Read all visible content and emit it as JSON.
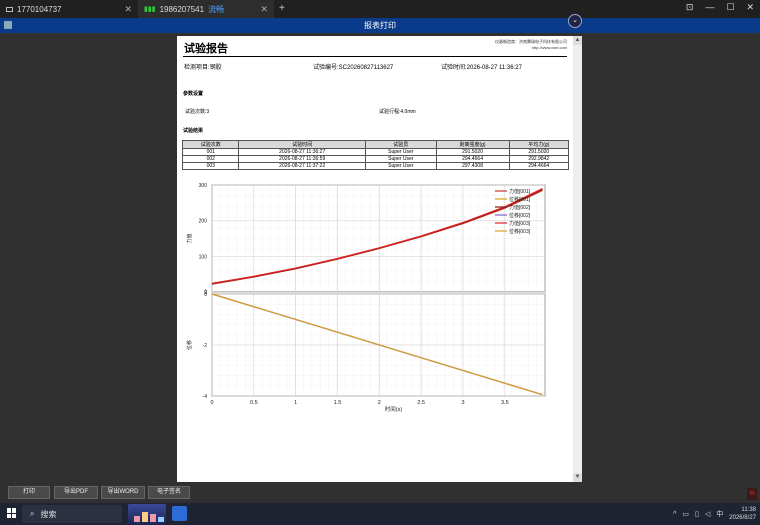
{
  "tabs": [
    {
      "label": "1770104737",
      "close": "✕"
    },
    {
      "signal": "▮▮▮",
      "label": "1986207541",
      "sublabel": "流畅",
      "close": "✕"
    }
  ],
  "new_tab": "+",
  "window_controls": [
    "⊡",
    "—",
    "☐",
    "✕"
  ],
  "app": {
    "title": "报表打印",
    "collapse_icon": "⌄"
  },
  "report": {
    "title": "试验报告",
    "company_line1": "仪器制造商：济南腾瑞电子科技有限公司",
    "company_line2": "http://www.csei.com",
    "item": "检测项目:钢胶",
    "code": "试验编号:SC20260827113627",
    "time": "试验时间:2026-08-27 11:36:27",
    "params_heading": "参数设置",
    "count": "试验次数:3",
    "stroke": "试验行程:4.0mm",
    "results_heading": "试验结果",
    "table": {
      "headers": [
        "试验次数",
        "试验时间",
        "试验员",
        "剥离强度(g)",
        "平均力(g)"
      ],
      "rows": [
        [
          "001",
          "2026-08-27 11:36:27",
          "Super User",
          "291.5020",
          "291.5020"
        ],
        [
          "002",
          "2026-08-27 11:36:59",
          "Super User",
          "294.4664",
          "292.9842"
        ],
        [
          "003",
          "2026-08-27 11:37:22",
          "Super User",
          "297.4308",
          "294.4664"
        ]
      ]
    }
  },
  "chart_data": {
    "type": "line",
    "xlabel": "时间(s)",
    "xlim": [
      0,
      3.98
    ],
    "x_ticks": [
      "0",
      "0.5",
      "1",
      "1.5",
      "2",
      "2.5",
      "3",
      "3.5"
    ],
    "x_tick_values": [
      0,
      0.5,
      1,
      1.5,
      2,
      2.5,
      3,
      3.5
    ],
    "panels": [
      {
        "ylabel": "力值",
        "ylim": [
          0,
          300
        ],
        "y_ticks": [
          "0",
          "2",
          "100",
          "200",
          "300"
        ],
        "y_tick_values": [
          0,
          2,
          100,
          200,
          300
        ]
      },
      {
        "ylabel": "位移",
        "ylim": [
          -4,
          0
        ],
        "y_ticks": [
          "-4",
          "-2",
          "0"
        ],
        "y_tick_values": [
          -4,
          -2,
          0
        ]
      }
    ],
    "grid": true,
    "legend_position": "top-right",
    "series": [
      {
        "name": "力值[001]",
        "panel": 0,
        "color": "#c0392b",
        "x": [
          0,
          0.5,
          1,
          1.5,
          2,
          2.5,
          3,
          3.5,
          3.95
        ],
        "values": [
          22,
          42,
          65,
          92,
          122,
          155,
          192,
          235,
          285
        ]
      },
      {
        "name": "位移[001]",
        "panel": 1,
        "color": "#d4a017",
        "x": [
          0,
          3.95
        ],
        "values": [
          0,
          -3.95
        ]
      },
      {
        "name": "力值[002]",
        "panel": 0,
        "color": "#8b1a1a",
        "x": [
          0,
          0.5,
          1,
          1.5,
          2,
          2.5,
          3,
          3.5,
          3.95
        ],
        "values": [
          23,
          43,
          66,
          93,
          123,
          156,
          193,
          237,
          288
        ]
      },
      {
        "name": "位移[002]",
        "panel": 1,
        "color": "#7a5cc4",
        "x": [
          0,
          3.95
        ],
        "values": [
          0,
          -3.95
        ]
      },
      {
        "name": "力值[003]",
        "panel": 0,
        "color": "#e02020",
        "x": [
          0,
          0.5,
          1,
          1.5,
          2,
          2.5,
          3,
          3.5,
          3.95
        ],
        "values": [
          24,
          44,
          67,
          94,
          124,
          157,
          195,
          239,
          290
        ]
      },
      {
        "name": "位移[003]",
        "panel": 1,
        "color": "#d9a030",
        "x": [
          0,
          3.95
        ],
        "values": [
          0,
          -3.95
        ]
      }
    ]
  },
  "buttons": {
    "print": "打印",
    "pdf": "导出PDF",
    "word": "导出WORD",
    "sign": "电子签名"
  },
  "red_badge": "%",
  "taskbar": {
    "search_icon": "⌕",
    "search_placeholder": "搜索",
    "tray_arrow": "^",
    "ime": "中",
    "time": "11:38",
    "date": "2026/8/27"
  }
}
